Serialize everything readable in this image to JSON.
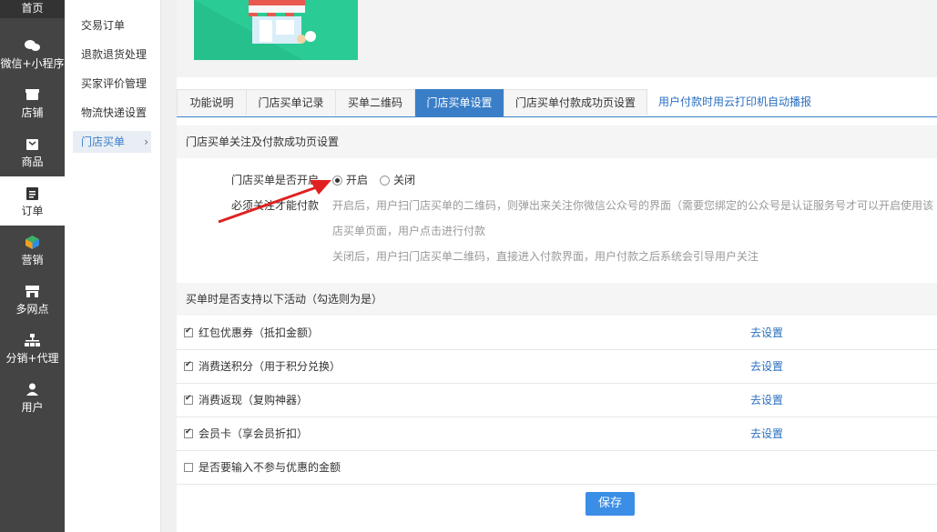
{
  "nav": {
    "top": "首页",
    "items": [
      {
        "label": "微信+小程序",
        "icon": "wechat-icon"
      },
      {
        "label": "店铺",
        "icon": "store-icon"
      },
      {
        "label": "商品",
        "icon": "product-icon"
      },
      {
        "label": "订单",
        "icon": "order-icon"
      },
      {
        "label": "营销",
        "icon": "marketing-icon"
      },
      {
        "label": "多网点",
        "icon": "multi-store-icon"
      },
      {
        "label": "分销+代理",
        "icon": "distribution-icon"
      },
      {
        "label": "用户",
        "icon": "user-icon"
      }
    ]
  },
  "subnav": {
    "items": [
      {
        "label": "交易订单"
      },
      {
        "label": "退款退货处理"
      },
      {
        "label": "买家评价管理"
      },
      {
        "label": "物流快递设置"
      },
      {
        "label": "门店买单"
      }
    ],
    "arrow": "›"
  },
  "tabs": [
    {
      "label": "功能说明"
    },
    {
      "label": "门店买单记录"
    },
    {
      "label": "买单二维码"
    },
    {
      "label": "门店买单设置"
    },
    {
      "label": "门店买单付款成功页设置"
    }
  ],
  "tab_link": "用户付款时用云打印机自动播报",
  "section1": {
    "title": "门店买单关注及付款成功页设置",
    "open_label": "门店买单是否开启",
    "radio_on": "开启",
    "radio_off": "关闭",
    "follow_label": "必须关注才能付款",
    "notes": [
      "开启后，用户扫门店买单的二维码，则弹出来关注你微信公众号的界面（需要您绑定的公众号是认证服务号才可以开启使用该",
      "店买单页面，用户点击进行付款",
      "关闭后，用户扫门店买单二维码，直接进入付款界面，用户付款之后系统会引导用户关注"
    ]
  },
  "section2": {
    "title": "买单时是否支持以下活动（勾选则为是）",
    "rows": [
      {
        "label": "红包优惠券（抵扣金额）",
        "link": "去设置",
        "checked": true
      },
      {
        "label": "消费送积分（用于积分兑换）",
        "link": "去设置",
        "checked": true
      },
      {
        "label": "消费返现（复购神器）",
        "link": "去设置",
        "checked": true
      },
      {
        "label": "会员卡（享会员折扣）",
        "link": "去设置",
        "checked": true
      },
      {
        "label": "是否要输入不参与优惠的金额",
        "link": "",
        "checked": false
      }
    ]
  },
  "save_label": "保存",
  "colors": {
    "accent": "#3a7ec8",
    "arrow": "#e02020",
    "banner": "#25c08c"
  }
}
